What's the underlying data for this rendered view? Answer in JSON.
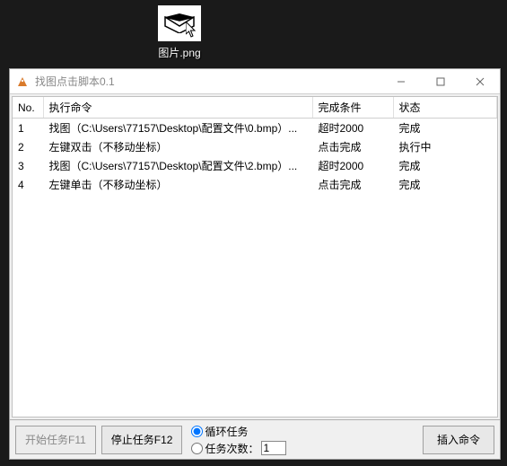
{
  "desktop": {
    "file_label": "图片.png"
  },
  "window": {
    "title": "找图点击脚本0.1"
  },
  "table": {
    "headers": {
      "no": "No.",
      "cmd": "执行命令",
      "cond": "完成条件",
      "status": "状态"
    },
    "rows": [
      {
        "no": "1",
        "cmd": "找图（C:\\Users\\77157\\Desktop\\配置文件\\0.bmp）...",
        "cond": "超时2000",
        "status": "完成"
      },
      {
        "no": "2",
        "cmd": "左键双击（不移动坐标）",
        "cond": "点击完成",
        "status": "执行中"
      },
      {
        "no": "3",
        "cmd": "找图（C:\\Users\\77157\\Desktop\\配置文件\\2.bmp）...",
        "cond": "超时2000",
        "status": "完成"
      },
      {
        "no": "4",
        "cmd": "左键单击（不移动坐标）",
        "cond": "点击完成",
        "status": "完成"
      }
    ]
  },
  "bottom": {
    "start_label": "开始任务F11",
    "stop_label": "停止任务F12",
    "loop_label": "循环任务",
    "count_label": "任务次数：",
    "count_value": "1",
    "insert_label": "插入命令"
  }
}
